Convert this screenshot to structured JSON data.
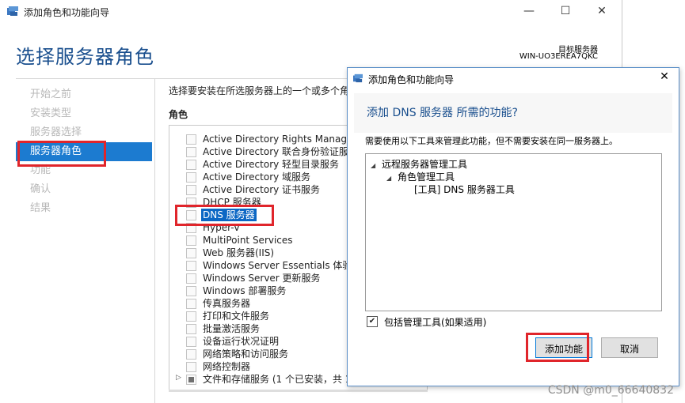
{
  "window": {
    "title": "添加角色和功能向导",
    "minimize": "—",
    "maximize": "☐",
    "close": "✕"
  },
  "page": {
    "title": "选择服务器角色",
    "dest_label": "目标服务器",
    "dest_name": "WIN-UO3EREA7QKC"
  },
  "nav": {
    "items": [
      "开始之前",
      "安装类型",
      "服务器选择",
      "服务器角色",
      "功能",
      "确认",
      "结果"
    ],
    "active_index": 3
  },
  "roles": {
    "instruction": "选择要安装在所选服务器上的一个或多个角",
    "heading": "角色",
    "items": [
      "Active Directory Rights Manage",
      "Active Directory 联合身份验证服务",
      "Active Directory 轻型目录服务",
      "Active Directory 域服务",
      "Active Directory 证书服务",
      "DHCP 服务器",
      "DNS 服务器",
      "Hyper-V",
      "MultiPoint Services",
      "Web 服务器(IIS)",
      "Windows Server Essentials 体验",
      "Windows Server 更新服务",
      "Windows 部署服务",
      "传真服务器",
      "打印和文件服务",
      "批量激活服务",
      "设备运行状况证明",
      "网络策略和访问服务",
      "网络控制器",
      "文件和存储服务 (1 个已安装，共 1"
    ],
    "selected_index": 6
  },
  "dialog": {
    "title": "添加角色和功能向导",
    "close": "✕",
    "heading": "添加 DNS 服务器 所需的功能?",
    "description": "需要使用以下工具来管理此功能，但不需要安装在同一服务器上。",
    "tree": [
      "远程服务器管理工具",
      "角色管理工具",
      "[工具] DNS 服务器工具"
    ],
    "include_tools_label": "包括管理工具(如果适用)",
    "include_tools_checked": true,
    "add_button": "添加功能",
    "cancel_button": "取消"
  },
  "watermark": "CSDN @m0_66640832",
  "colors": {
    "accent": "#1c7bd0",
    "title_blue": "#1a4f8e",
    "highlight_red": "#e0252b"
  }
}
